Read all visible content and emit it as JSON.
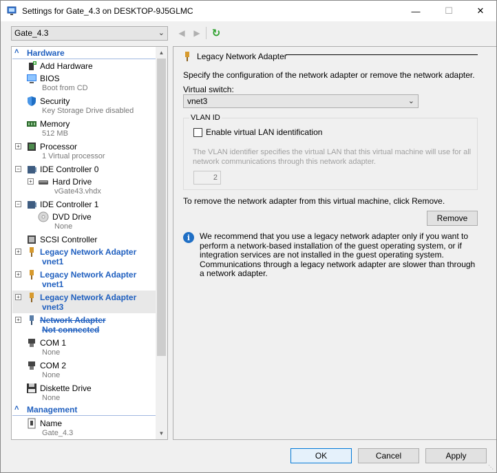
{
  "window": {
    "title": "Settings for Gate_4.3 on DESKTOP-9J5GLMC",
    "minimize_glyph": "—",
    "maximize_glyph": "☐",
    "close_glyph": "✕"
  },
  "toolbar": {
    "vm_selected": "Gate_4.3",
    "back_icon": "back-arrow-icon",
    "forward_icon": "forward-arrow-icon",
    "refresh_icon": "refresh-icon"
  },
  "tree": {
    "hardware_label": "Hardware",
    "management_label": "Management",
    "items": [
      {
        "label": "Add Hardware",
        "sub": ""
      },
      {
        "label": "BIOS",
        "sub": "Boot from CD"
      },
      {
        "label": "Security",
        "sub": "Key Storage Drive disabled"
      },
      {
        "label": "Memory",
        "sub": "512 MB"
      },
      {
        "label": "Processor",
        "sub": "1 Virtual processor"
      },
      {
        "label": "IDE Controller 0",
        "sub": ""
      },
      {
        "label": "Hard Drive",
        "sub": "vGate43.vhdx"
      },
      {
        "label": "IDE Controller 1",
        "sub": ""
      },
      {
        "label": "DVD Drive",
        "sub": "None"
      },
      {
        "label": "SCSI Controller",
        "sub": ""
      },
      {
        "label": "Legacy Network Adapter",
        "sub": "vnet1"
      },
      {
        "label": "Legacy Network Adapter",
        "sub": "vnet1"
      },
      {
        "label": "Legacy Network Adapter",
        "sub": "vnet3"
      },
      {
        "label": "Network Adapter",
        "sub": "Not connected"
      },
      {
        "label": "COM 1",
        "sub": "None"
      },
      {
        "label": "COM 2",
        "sub": "None"
      },
      {
        "label": "Diskette Drive",
        "sub": "None"
      },
      {
        "label": "Name",
        "sub": "Gate_4.3"
      }
    ]
  },
  "detail": {
    "group_title": "Legacy Network Adapter",
    "description": "Specify the configuration of the network adapter or remove the network adapter.",
    "virtual_switch_label": "Virtual switch:",
    "virtual_switch_value": "vnet3",
    "vlan_legend": "VLAN ID",
    "vlan_checkbox_label": "Enable virtual LAN identification",
    "vlan_description": "The VLAN identifier specifies the virtual LAN that this virtual machine will use for all network communications through this network adapter.",
    "vlan_value": "2",
    "remove_text": "To remove the network adapter from this virtual machine, click Remove.",
    "remove_button": "Remove",
    "info_text": "We recommend that you use a legacy network adapter only if you want to perform a network-based installation of the guest operating system, or if integration services are not installed in the guest operating system. Communications through a legacy network adapter are slower than through a network adapter."
  },
  "footer": {
    "ok": "OK",
    "cancel": "Cancel",
    "apply": "Apply"
  },
  "colors": {
    "accent": "#1f5fbf",
    "info": "#1f6fc5"
  }
}
